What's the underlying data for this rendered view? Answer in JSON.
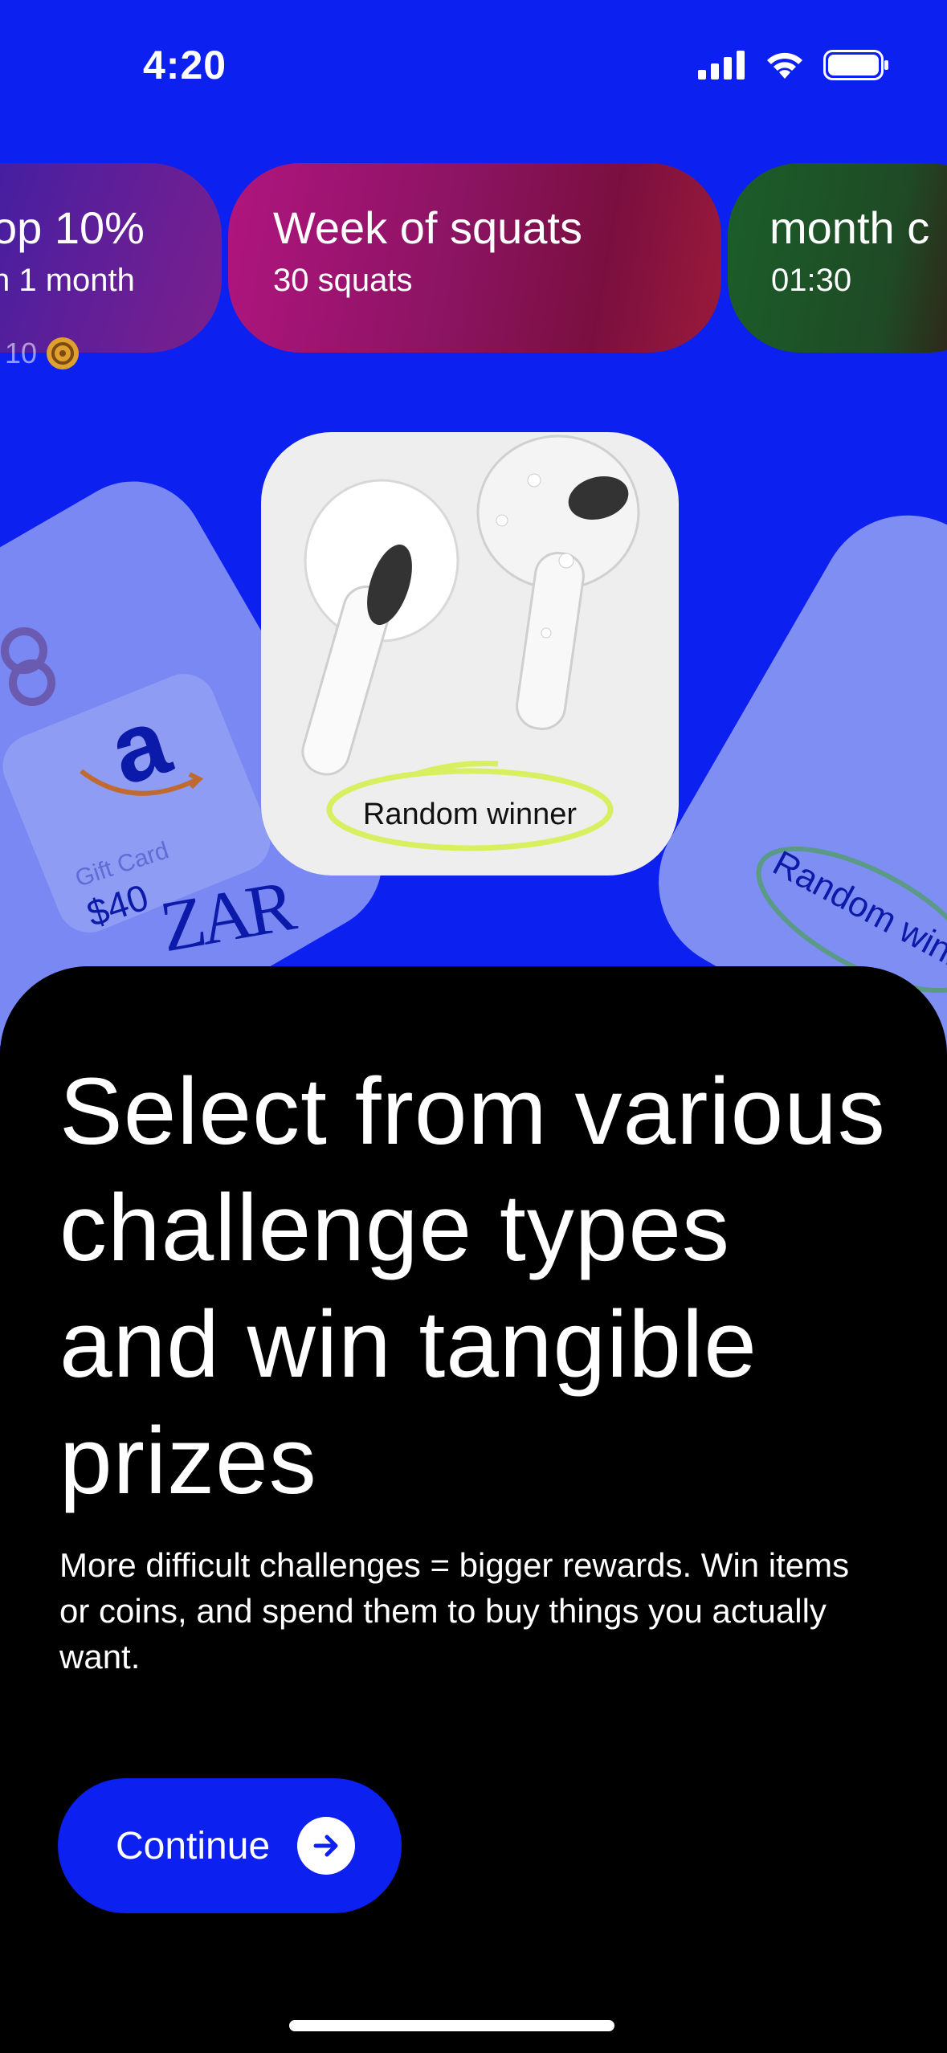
{
  "status_bar": {
    "time": "4:20",
    "icons": [
      "cellular-signal-icon",
      "wifi-icon",
      "battery-icon"
    ]
  },
  "challenges": [
    {
      "title": "op 10%",
      "subtitle": "n 1 month",
      "reward": "10"
    },
    {
      "title": "Week of squats",
      "subtitle": "30 squats"
    },
    {
      "title": "month c",
      "subtitle": "01:30"
    }
  ],
  "prizes": {
    "left": {
      "gift_card_text": "Gift Card",
      "amount": "$40",
      "brand": "ZAR"
    },
    "center": {
      "label": "Random winner"
    },
    "right": {
      "label": "Random winn"
    }
  },
  "content": {
    "headline": "Select from various challenge types and win tangible prizes",
    "body": "More difficult challenges = bigger rewards. Win items or coins, and spend them to buy things you actually want.",
    "continue_label": "Continue"
  },
  "colors": {
    "accent": "#0c20f0",
    "sheet_bg": "#000000",
    "card_bg": "#eeeeee",
    "highlight": "#d8f060"
  }
}
